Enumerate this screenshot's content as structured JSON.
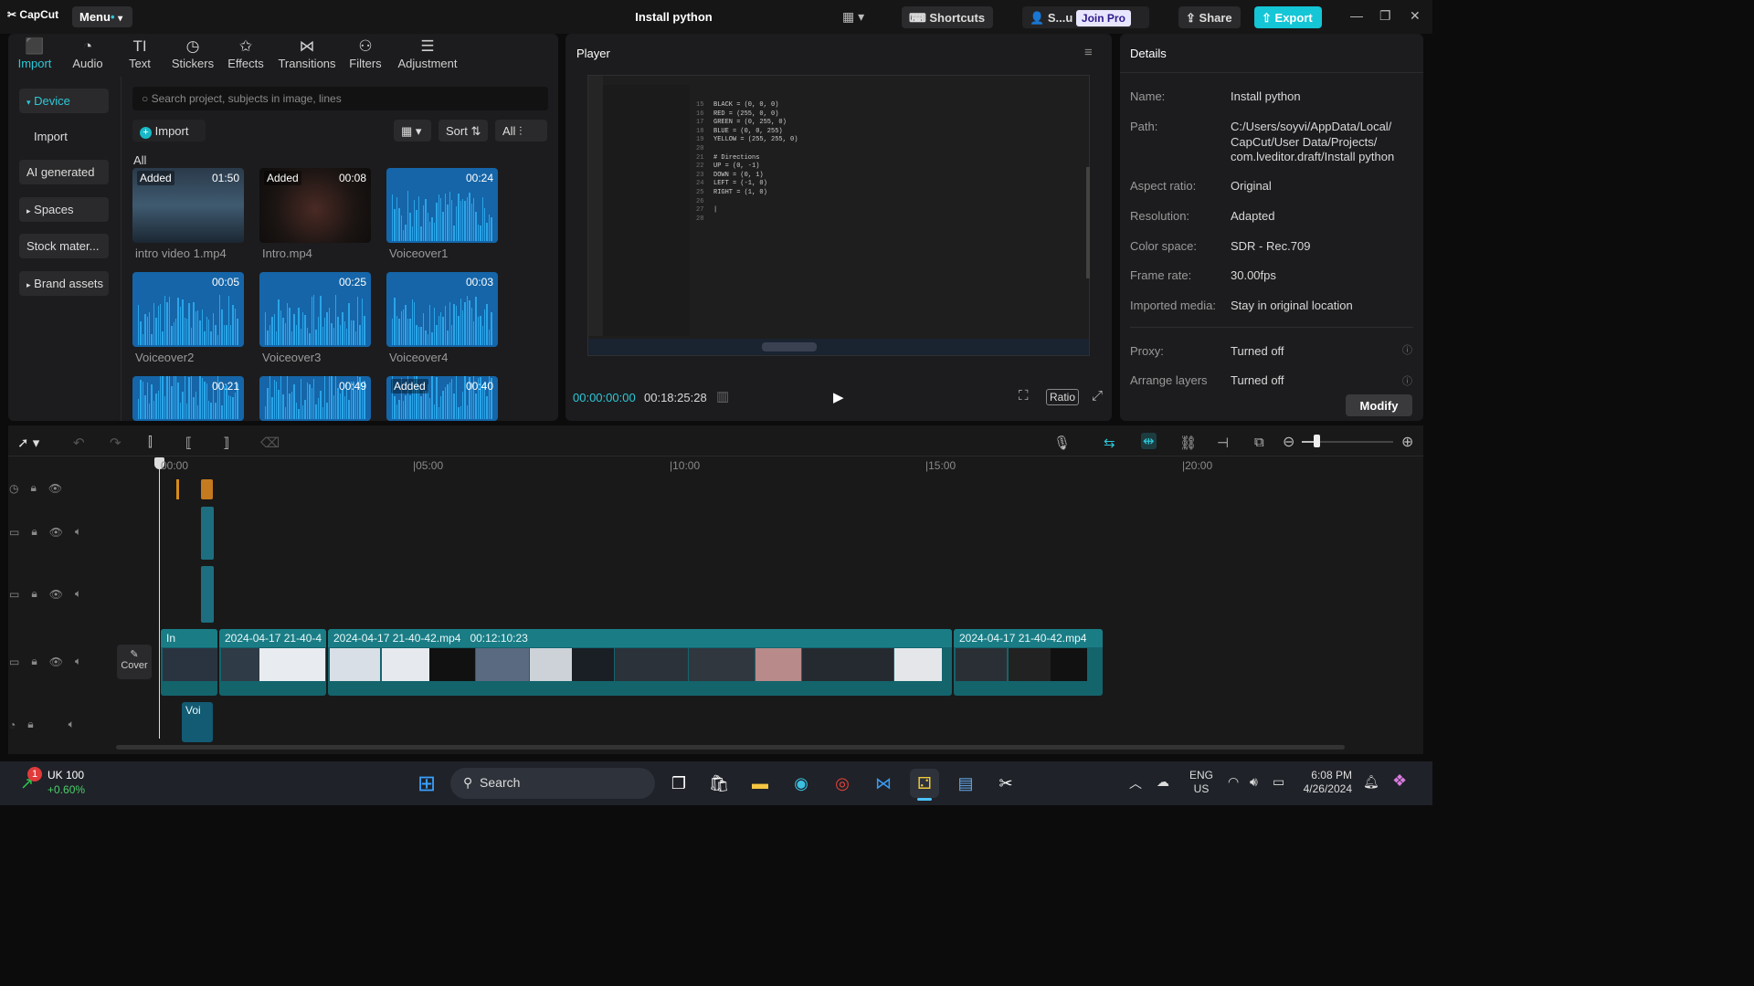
{
  "app": {
    "logo": "CapCut",
    "menu": "Menu",
    "title": "Install python",
    "shortcuts": "Shortcuts",
    "user": "S...u",
    "join_pro": "Join Pro",
    "share": "Share",
    "export": "Export"
  },
  "toolbar": [
    {
      "label": "Import",
      "icon": "import-icon",
      "glyph": "⬛"
    },
    {
      "label": "Audio",
      "icon": "audio-icon",
      "glyph": "◔"
    },
    {
      "label": "Text",
      "icon": "text-icon",
      "glyph": "TI"
    },
    {
      "label": "Stickers",
      "icon": "stickers-icon",
      "glyph": "◷"
    },
    {
      "label": "Effects",
      "icon": "effects-icon",
      "glyph": "✩"
    },
    {
      "label": "Transitions",
      "icon": "transitions-icon",
      "glyph": "⋈"
    },
    {
      "label": "Filters",
      "icon": "filters-icon",
      "glyph": "⚇"
    },
    {
      "label": "Adjustment",
      "icon": "adjustment-icon",
      "glyph": "☰"
    }
  ],
  "sidebar": {
    "device": "Device",
    "import": "Import",
    "ai_generated": "AI generated",
    "spaces": "Spaces",
    "stock": "Stock mater...",
    "brand": "Brand assets"
  },
  "media": {
    "search_placeholder": "Search project, subjects in image, lines",
    "import_btn": "Import",
    "sort": "Sort",
    "all_filter": "All",
    "section": "All",
    "items": [
      {
        "name": "intro video 1.mp4",
        "duration": "01:50",
        "added": "Added"
      },
      {
        "name": "Intro.mp4",
        "duration": "00:08",
        "added": "Added"
      },
      {
        "name": "Voiceover1",
        "duration": "00:24",
        "added": ""
      },
      {
        "name": "Voiceover2",
        "duration": "00:05",
        "added": ""
      },
      {
        "name": "Voiceover3",
        "duration": "00:25",
        "added": ""
      },
      {
        "name": "Voiceover4",
        "duration": "00:03",
        "added": ""
      },
      {
        "name": "",
        "duration": "00:21",
        "added": ""
      },
      {
        "name": "",
        "duration": "00:49",
        "added": ""
      },
      {
        "name": "",
        "duration": "00:40",
        "added": "Added"
      }
    ]
  },
  "player": {
    "title": "Player",
    "current_time": "00:00:00:00",
    "total_time": "00:18:25:28",
    "ratio": "Ratio",
    "line_numbers": "15\n16\n17\n18\n19\n20\n21\n22\n23\n24\n25\n26\n27\n28",
    "code": "BLACK = (0, 0, 0)\nRED = (255, 0, 0)\nGREEN = (0, 255, 0)\nBLUE = (0, 0, 255)\nYELLOW = (255, 255, 0)\n\n# Directions\nUP = (0, -1)\nDOWN = (0, 1)\nLEFT = (-1, 0)\nRIGHT = (1, 0)\n\n|\n"
  },
  "details": {
    "title": "Details",
    "rows": [
      {
        "label": "Name:",
        "value": "Install python"
      },
      {
        "label": "Path:",
        "value": "C:/Users/soyvi/AppData/Local/\nCapCut/User Data/Projects/\ncom.lveditor.draft/Install python"
      },
      {
        "label": "Aspect ratio:",
        "value": "Original"
      },
      {
        "label": "Resolution:",
        "value": "Adapted"
      },
      {
        "label": "Color space:",
        "value": "SDR - Rec.709"
      },
      {
        "label": "Frame rate:",
        "value": "30.00fps"
      },
      {
        "label": "Imported media:",
        "value": "Stay in original location"
      },
      {
        "label": "Proxy:",
        "value": "Turned off"
      },
      {
        "label": "Arrange layers",
        "value": "Turned off"
      }
    ],
    "modify": "Modify"
  },
  "timeline": {
    "ruler": [
      "00:00",
      "|05:00",
      "|10:00",
      "|15:00",
      "|20:00"
    ],
    "clip_labels": [
      "In",
      "2024-04-17 21-40-4",
      "2024-04-17 21-40-42.mp4",
      "00:12:10:23",
      "2024-04-17 21-40-42.mp4"
    ],
    "cover": "Cover",
    "audio_clip": "Voi"
  },
  "taskbar": {
    "stock_name": "UK 100",
    "stock_change": "+0.60%",
    "badge": "1",
    "search": "Search",
    "lang1": "ENG",
    "lang2": "US",
    "time": "6:08 PM",
    "date": "4/26/2024"
  }
}
